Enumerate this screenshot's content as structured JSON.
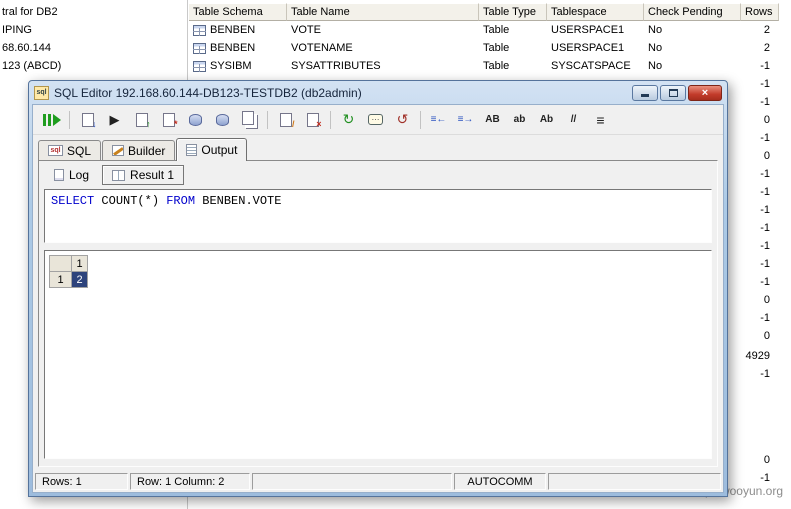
{
  "background": {
    "tree_items": [
      "tral for DB2",
      "IPING",
      "68.60.144",
      "123 (ABCD)"
    ],
    "table": {
      "columns": [
        "Table Schema",
        "Table Name",
        "Table Type",
        "Tablespace",
        "Check Pending",
        "Rows"
      ],
      "rows": [
        {
          "schema": "BENBEN",
          "name": "VOTE",
          "type": "Table",
          "tablespace": "USERSPACE1",
          "check_pending": "No"
        },
        {
          "schema": "BENBEN",
          "name": "VOTENAME",
          "type": "Table",
          "tablespace": "USERSPACE1",
          "check_pending": "No"
        },
        {
          "schema": "SYSIBM",
          "name": "SYSATTRIBUTES",
          "type": "Table",
          "tablespace": "SYSCATSPACE",
          "check_pending": "No"
        }
      ],
      "rows_values": [
        "2",
        "2",
        "-1",
        "-1",
        "-1",
        "0",
        "-1",
        "0",
        "-1",
        "-1",
        "-1",
        "-1",
        "-1",
        "-1",
        "-1",
        "0",
        "-1",
        "0",
        "4929",
        "-1"
      ],
      "rows_values_bottom": [
        "0",
        "-1"
      ]
    },
    "watermark": "drops.wooyun.org"
  },
  "window": {
    "title": "SQL Editor  192.168.60.144-DB123-TESTDB2 (db2admin)",
    "icon_label": "sql",
    "buttons": {
      "close_glyph": "×"
    },
    "toolbar": {
      "run_glyph": "▶",
      "export_glyph": "↓",
      "open_glyph": "↑",
      "assist_glyph": "*",
      "edit_glyph": "/",
      "clear_glyph": "×",
      "commit_glyph": "↻",
      "messages_glyph": "⋯",
      "rollback_glyph": "↺",
      "outdent_glyph": "≡←",
      "indent_glyph": "≡→",
      "uppercase": "AB",
      "lowercase": "ab",
      "capitalize": "Ab",
      "comment_glyph": "//",
      "format_glyph": "≡"
    },
    "tabs": [
      {
        "label": "SQL",
        "icon_label": "sql"
      },
      {
        "label": "Builder"
      },
      {
        "label": "Output"
      }
    ],
    "subtabs": [
      {
        "label": "Log"
      },
      {
        "label": "Result 1"
      }
    ],
    "sql": {
      "kw1": "SELECT",
      "mid": " COUNT(*) ",
      "kw2": "FROM",
      "rest": " BENBEN.VOTE"
    },
    "result_grid": {
      "col_header": "1",
      "row_header": "1",
      "cell_value": "2"
    },
    "status": {
      "rows": "Rows: 1",
      "position": "Row: 1  Column: 2",
      "autocommit": "AUTOCOMM"
    },
    "colors": {
      "keyword": "#0000cc",
      "selected_cell": "#2d437c",
      "titlebar": "#a9c6e4",
      "close_button": "#c23b2a"
    }
  }
}
